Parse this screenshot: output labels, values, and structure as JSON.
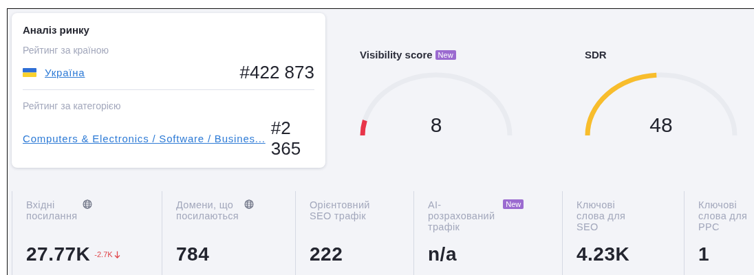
{
  "market": {
    "title": "Аналіз ринку",
    "country_label": "Рейтинг за країною",
    "country": "Україна",
    "country_rank": "#422 873",
    "category_label": "Рейтинг за категорією",
    "category": "Computers & Electronics / Software / Busines...",
    "category_rank": "#2 365"
  },
  "gauges": [
    {
      "title": "Visibility score",
      "badge": "New",
      "value": "8",
      "color": "#e8354a"
    },
    {
      "title": "SDR",
      "value": "48",
      "color": "#f8bd2c"
    }
  ],
  "stats": [
    {
      "label": "Вхідні\nпосилання",
      "globe": true,
      "value": "27.77K",
      "delta": "-2.7K"
    },
    {
      "label": "Домени, що\nпосилаються",
      "globe": true,
      "value": "784"
    },
    {
      "label": "Орієнтовний\nSEO трафік",
      "globe": false,
      "value": "222"
    },
    {
      "label": "AI-\nрозрахований\nтрафік",
      "globe": false,
      "badge": "New",
      "value": "n/a"
    },
    {
      "label": "Ключові\nслова для\nSEO",
      "globe": false,
      "value": "4.23K"
    },
    {
      "label": "Ключові\nслова для\nPPC",
      "globe": false,
      "value": "1"
    }
  ]
}
